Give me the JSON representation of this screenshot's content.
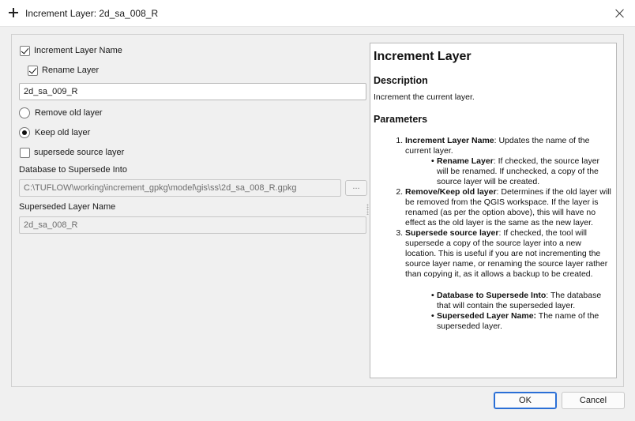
{
  "window": {
    "title": "Increment Layer: 2d_sa_008_R",
    "icon": "plus-icon"
  },
  "form": {
    "increment_layer_name": {
      "label": "Increment Layer Name",
      "checked": true
    },
    "rename_layer": {
      "label": "Rename Layer",
      "checked": true
    },
    "new_name_value": "2d_sa_009_R",
    "remove_old_layer": {
      "label": "Remove old layer",
      "selected": false
    },
    "keep_old_layer": {
      "label": "Keep old layer",
      "selected": true
    },
    "supersede_source_layer": {
      "label": "supersede source layer",
      "checked": false
    },
    "database_label": "Database to Supersede Into",
    "database_value": "C:\\TUFLOW\\working\\increment_gpkg\\model\\gis\\ss\\2d_sa_008_R.gpkg",
    "browse_label": "...",
    "superseded_layer_label": "Superseded Layer Name",
    "superseded_layer_value": "2d_sa_008_R"
  },
  "help": {
    "title": "Increment Layer",
    "description_heading": "Description",
    "description_text": "Increment the current layer.",
    "parameters_heading": "Parameters",
    "items": [
      {
        "term": "Increment Layer Name",
        "text": ": Updates the name of the current layer."
      },
      {
        "term": "Rename Layer",
        "text": ": If checked, the source layer will be renamed. If unchecked, a copy of the source layer will be created."
      },
      {
        "term": "Remove/Keep old layer",
        "text": ": Determines if the old layer will be removed from the QGIS workspace. If the layer is renamed (as per the option above), this will have no effect as the old layer is the same as the new layer."
      },
      {
        "term": "Supersede source layer",
        "text": ": If checked, the tool will supersede a copy of the source layer into a new location. This is useful if you are not incrementing the source layer name, or renaming the source layer rather than copying it, as it allows a backup to be created."
      },
      {
        "term": "Database to Supersede Into",
        "text": ": The database that will contain the superseded layer."
      },
      {
        "term": "Superseded Layer Name:",
        "text": " The name of the superseded layer."
      }
    ]
  },
  "buttons": {
    "ok": "OK",
    "cancel": "Cancel"
  },
  "colors": {
    "accent": "#2a6fd6",
    "background": "#f0f0f0"
  }
}
